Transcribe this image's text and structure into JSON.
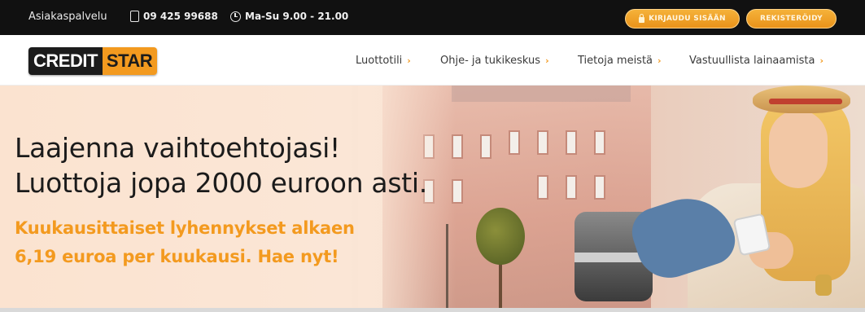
{
  "topbar": {
    "support_label": "Asiakaspalvelu",
    "phone": "09 425 99688",
    "hours": "Ma-Su 9.00 - 21.00",
    "login_label": "KIRJAUDU SISÄÄN",
    "register_label": "REKISTERÖIDY"
  },
  "logo": {
    "part1": "CREDIT",
    "part2": "STAR"
  },
  "nav": {
    "items": [
      {
        "label": "Luottotili"
      },
      {
        "label": "Ohje- ja tukikeskus"
      },
      {
        "label": "Tietoja meistä"
      },
      {
        "label": "Vastuullista lainaamista"
      }
    ],
    "chevron": "›"
  },
  "hero": {
    "headline_line1": "Laajenna vaihtoehtojasi!",
    "headline_line2": "Luottoja jopa 2000 euroon asti.",
    "sub_line1": "Kuukausittaiset lyhennykset alkaen",
    "sub_line2": "6,19 euroa per kuukausi. Hae nyt!"
  },
  "colors": {
    "accent": "#f39a1f",
    "topbar_bg": "#111111",
    "text_dark": "#1b1b1b"
  },
  "icons": [
    "phone-icon",
    "clock-icon",
    "lock-icon",
    "chevron-right-icon"
  ]
}
